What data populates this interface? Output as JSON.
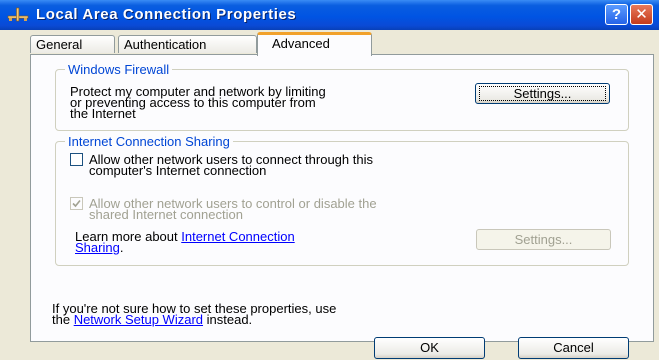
{
  "window": {
    "title": "Local Area Connection Properties",
    "title_icon": "network-connection-icon",
    "help_label": "?",
    "close_label": "✕"
  },
  "tabs": [
    {
      "label": "General",
      "active": false
    },
    {
      "label": "Authentication",
      "active": false
    },
    {
      "label": "Advanced",
      "active": true
    }
  ],
  "firewall": {
    "legend": "Windows Firewall",
    "description_line1": "Protect my computer and network by limiting",
    "description_line2": "or preventing access to this computer from",
    "description_line3": "the Internet",
    "settings_button": "Settings..."
  },
  "ics": {
    "legend": "Internet Connection Sharing",
    "allow_connect": {
      "line1": "Allow other network users to connect through this",
      "line2": "computer's Internet connection",
      "checked": false,
      "enabled": true
    },
    "allow_control": {
      "line1": "Allow other network users to control or disable the",
      "line2": "shared Internet connection",
      "checked": true,
      "enabled": false
    },
    "learn_more_prefix": "Learn more about ",
    "learn_more_link_part1": "Internet Connection",
    "learn_more_link_part2": "Sharing",
    "learn_more_suffix": ".",
    "settings_button": "Settings..."
  },
  "footer": {
    "line1": "If you're not sure how to set these properties, use",
    "line2_prefix": "the ",
    "wizard_link": "Network Setup Wizard",
    "line2_suffix": " instead."
  },
  "buttons": {
    "ok": "OK",
    "cancel": "Cancel"
  },
  "colors": {
    "titlebar": "#0054e3",
    "window_bg": "#ece9d8",
    "group_label": "#0046d5",
    "link": "#0000ff",
    "active_tab_accent": "#f1a12b",
    "disabled_text": "#a1a192"
  }
}
